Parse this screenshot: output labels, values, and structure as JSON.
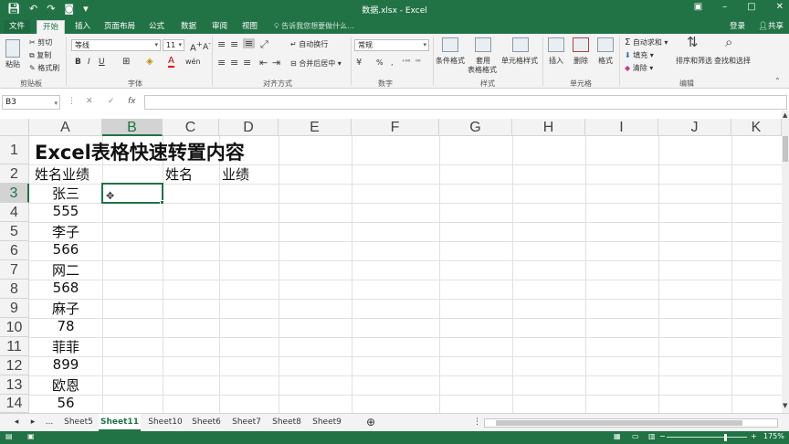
{
  "window": {
    "title": "数据.xlsx - Excel",
    "controls": [
      "–",
      "□",
      "✕"
    ]
  },
  "ribbon_tabs": [
    "文件",
    "开始",
    "插入",
    "页面布局",
    "公式",
    "数据",
    "审阅",
    "视图"
  ],
  "active_tab": "开始",
  "tell_me": "告诉我您想要做什么...",
  "login": "登录",
  "share": "共享",
  "clipboard": {
    "paste": "粘贴",
    "cut": "剪切",
    "copy": "复制",
    "painter": "格式刷",
    "group": "剪贴板"
  },
  "font": {
    "name": "等线",
    "size": "11",
    "bold": "B",
    "italic": "I",
    "underline": "U",
    "group": "字体"
  },
  "alignment": {
    "wrap": "自动换行",
    "merge": "合并后居中",
    "group": "对齐方式"
  },
  "number": {
    "format": "常规",
    "pct": "%",
    "comma": ",",
    "group": "数字"
  },
  "styles": {
    "cond": "条件格式",
    "table_l1": "套用",
    "table_l2": "表格格式",
    "cell": "单元格样式",
    "group": "样式"
  },
  "cells": {
    "insert": "插入",
    "delete": "删除",
    "format": "格式",
    "group": "单元格"
  },
  "editing": {
    "autosum": "自动求和",
    "fill": "填充",
    "clear": "清除",
    "sort": "排序和筛选",
    "find": "查找和选择",
    "group": "编辑"
  },
  "formula_bar": {
    "name_box": "B3",
    "fx": "fx",
    "value": ""
  },
  "columns": [
    "A",
    "B",
    "C",
    "D",
    "E",
    "F",
    "G",
    "H",
    "I",
    "J",
    "K"
  ],
  "selected_column": "B",
  "rows": [
    "1",
    "2",
    "3",
    "4",
    "5",
    "6",
    "7",
    "8",
    "9",
    "10",
    "11",
    "12",
    "13",
    "14"
  ],
  "selected_row": "3",
  "cells_data": {
    "A1": "Excel表格快速转置内容",
    "A2": "姓名业绩",
    "C2": "姓名",
    "D2": "业绩",
    "A3": "张三",
    "A4": "555",
    "A5": "李子",
    "A6": "566",
    "A7": "网二",
    "A8": "568",
    "A9": "麻子",
    "A10": "78",
    "A11": "菲菲",
    "A12": "899",
    "A13": "欧恩",
    "A14": "56"
  },
  "sheets": [
    "Sheet5",
    "Sheet11",
    "Sheet10",
    "Sheet6",
    "Sheet7",
    "Sheet8",
    "Sheet9"
  ],
  "active_sheet": "Sheet11",
  "sheet_more": "...",
  "status": {
    "zoom": "175%"
  },
  "colors": {
    "excel_green": "#217346"
  }
}
